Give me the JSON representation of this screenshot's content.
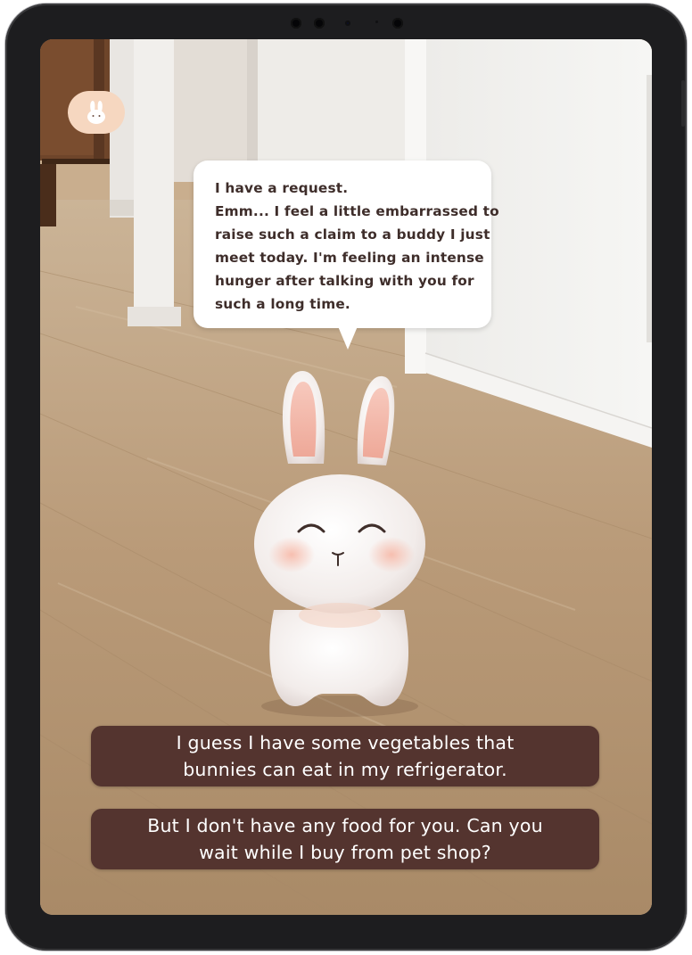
{
  "speech_bubble": {
    "lines": [
      "I have a request.",
      "Emm... I feel a little embarrassed to",
      "raise such a claim to a buddy I just",
      "meet today.  I'm feeling an intense",
      "hunger after talking with you for",
      "such a long time."
    ]
  },
  "reply_options": [
    {
      "lines": [
        "I guess I have some vegetables that",
        "bunnies can eat in my refrigerator."
      ]
    },
    {
      "lines": [
        "But I don't have any food for you. Can you",
        "wait while I buy from pet shop?"
      ]
    }
  ],
  "icons": {
    "app_icon": "bunny-face-icon"
  },
  "colors": {
    "option_bg": "#54342f",
    "app_icon_bg": "#f6d7c0",
    "bubble_text": "#3e2d2a"
  }
}
